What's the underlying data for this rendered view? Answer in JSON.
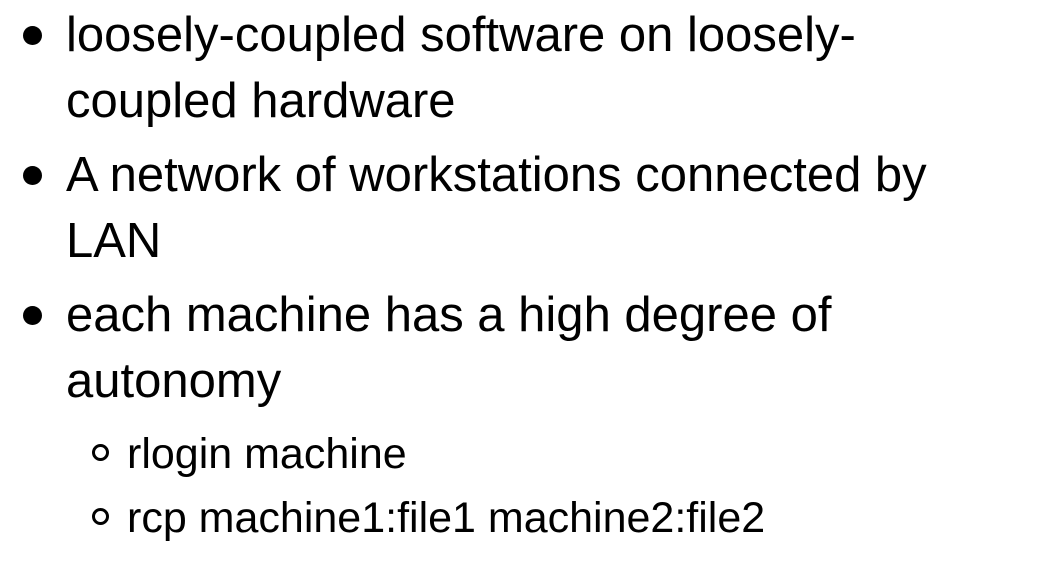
{
  "slide": {
    "bullets": [
      {
        "text": "loosely-coupled software on loosely-coupled hardware"
      },
      {
        "text": "A network of workstations connected by LAN"
      },
      {
        "text": "each machine has a high degree of autonomy",
        "sub_bullets": [
          {
            "text": "rlogin machine"
          },
          {
            "text": "rcp machine1:file1 machine2:file2"
          }
        ]
      }
    ]
  }
}
